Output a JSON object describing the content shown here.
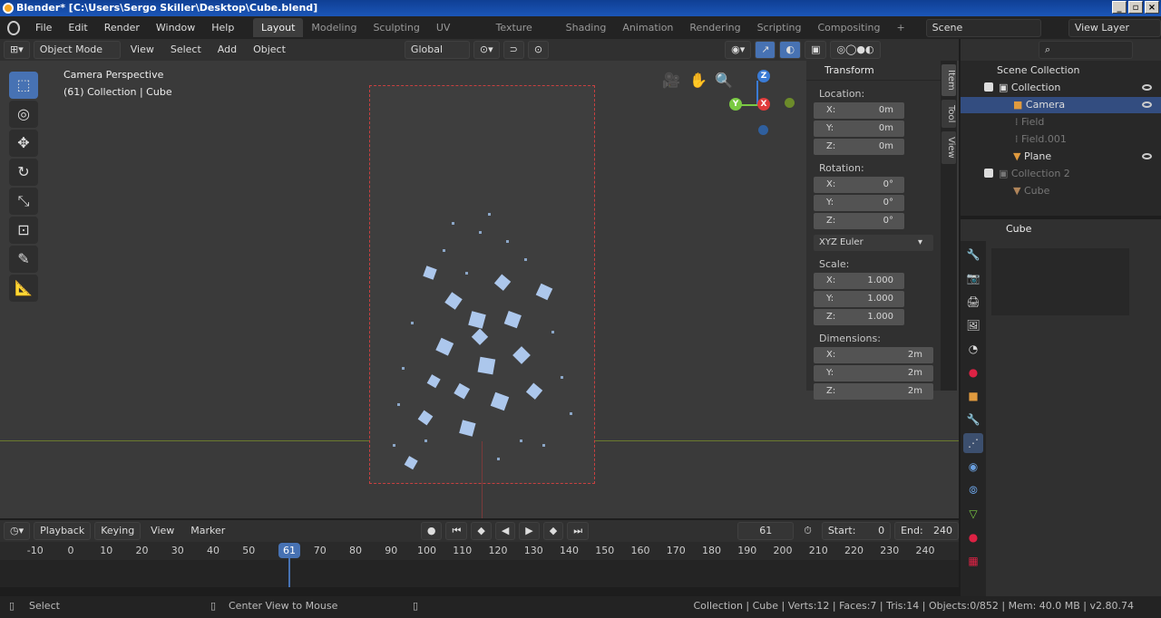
{
  "window": {
    "title": "Blender* [C:\\Users\\Sergo Skiller\\Desktop\\Cube.blend]",
    "controls": [
      "_",
      "▫",
      "×"
    ]
  },
  "menu": [
    "File",
    "Edit",
    "Render",
    "Window",
    "Help"
  ],
  "workspaces": [
    "Layout",
    "Modeling",
    "Sculpting",
    "UV Editing",
    "Texture Paint",
    "Shading",
    "Animation",
    "Rendering",
    "Scripting",
    "Compositing"
  ],
  "scene": "Scene",
  "view_layer": "View Layer",
  "header3d": {
    "mode": "Object Mode",
    "items": [
      "View",
      "Select",
      "Add",
      "Object"
    ],
    "orientation": "Global"
  },
  "viewport": {
    "line1": "Camera Perspective",
    "line2": "(61) Collection | Cube"
  },
  "gizmo": {
    "x": "X",
    "y": "Y",
    "z": "Z"
  },
  "transform": {
    "title": "Transform",
    "location_label": "Location:",
    "location": [
      {
        "k": "X:",
        "v": "0m"
      },
      {
        "k": "Y:",
        "v": "0m"
      },
      {
        "k": "Z:",
        "v": "0m"
      }
    ],
    "rotation_label": "Rotation:",
    "rotation": [
      {
        "k": "X:",
        "v": "0°"
      },
      {
        "k": "Y:",
        "v": "0°"
      },
      {
        "k": "Z:",
        "v": "0°"
      }
    ],
    "euler": "XYZ Euler",
    "scale_label": "Scale:",
    "scale": [
      {
        "k": "X:",
        "v": "1.000"
      },
      {
        "k": "Y:",
        "v": "1.000"
      },
      {
        "k": "Z:",
        "v": "1.000"
      }
    ],
    "dim_label": "Dimensions:",
    "dims": [
      {
        "k": "X:",
        "v": "2m"
      },
      {
        "k": "Y:",
        "v": "2m"
      },
      {
        "k": "Z:",
        "v": "2m"
      }
    ]
  },
  "side_tabs": [
    "Item",
    "Tool",
    "View"
  ],
  "outliner": {
    "root": "Scene Collection",
    "items": [
      "Collection",
      "Camera",
      "Field",
      "Field.001",
      "Plane",
      "Collection 2",
      "Cube"
    ]
  },
  "props": {
    "object": "Cube"
  },
  "timeline": {
    "menus": [
      "Playback",
      "Keying",
      "View",
      "Marker"
    ],
    "current": "61",
    "start_label": "Start:",
    "start": "0",
    "end_label": "End:",
    "end": "240",
    "ticks": [
      "-10",
      "0",
      "10",
      "20",
      "30",
      "40",
      "50",
      "70",
      "80",
      "90",
      "100",
      "110",
      "120",
      "130",
      "140",
      "150",
      "160",
      "170",
      "180",
      "190",
      "200",
      "210",
      "220",
      "230",
      "240"
    ],
    "playhead": "61"
  },
  "status": {
    "select": "Select",
    "center": "Center View to Mouse",
    "info": "Collection | Cube | Verts:12 | Faces:7 | Tris:14 | Objects:0/852 | Mem: 40.0 MB | v2.80.74"
  }
}
